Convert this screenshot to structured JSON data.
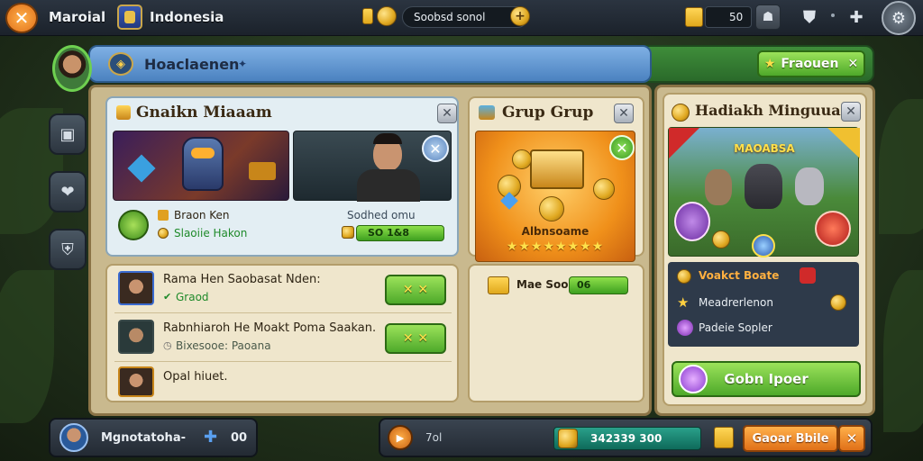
{
  "topbar": {
    "title": "Maroial",
    "region": "Indonesia",
    "search_text": "Soobsd sonol",
    "currency_value": "50"
  },
  "header": {
    "title": "Hoaclaenen",
    "right_button": "Fraouen"
  },
  "card_left": {
    "title": "Gnaikn Miaaam",
    "stat1": "Braon Ken",
    "stat2": "Slaoiie Hakon",
    "player_label": "Sodhed omu",
    "player_bar_value": "SO 1&8",
    "rows": [
      {
        "title": "Rama Hen Saobasat Nden:",
        "sub": "Graod"
      },
      {
        "title": "Rabnhiaroh He Moakt Poma Saakan.",
        "sub": "Bixesooe: Paoana"
      },
      {
        "title": "Opal hiuet.",
        "sub": ""
      }
    ]
  },
  "card_mid": {
    "title": "Grup Grup",
    "banner": "Albnsoame",
    "stars": "★★★★★★★★",
    "price_label": "Mae Sooe",
    "price_value": "06"
  },
  "card_right": {
    "title": "Hadiakh Minguuan",
    "banner": "MAOABSA",
    "rewards": [
      {
        "label": "Voakct Boate",
        "icon": "gold-coin-icon"
      },
      {
        "label": "Meadrerlenon",
        "icon": "star-icon"
      },
      {
        "label": "Padeie Sopler",
        "icon": "purple-gem-icon"
      }
    ],
    "collect_button": "Gobn Ipoer"
  },
  "bottom": {
    "player_name": "Mgnotatoha-",
    "player_count": "00",
    "mid_label": "7ol",
    "gold_value": "342339 300",
    "action_button": "Gaoar Bbile"
  },
  "colors": {
    "accent_green": "#4ea92a",
    "accent_orange": "#e07018",
    "header_blue": "#4b82c0",
    "panel_tan": "#c9b98e"
  }
}
